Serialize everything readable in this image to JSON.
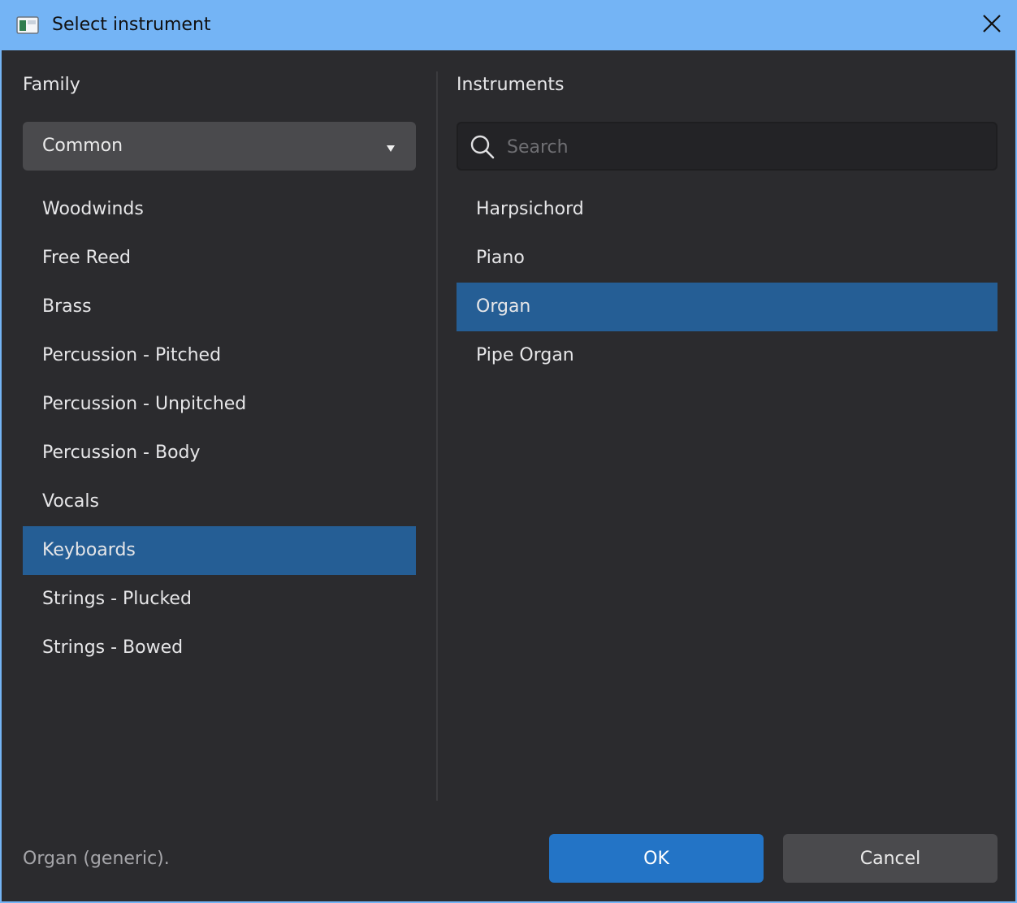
{
  "window": {
    "title": "Select instrument"
  },
  "family": {
    "heading": "Family",
    "dropdown_value": "Common",
    "items": [
      {
        "label": "Woodwinds",
        "selected": false
      },
      {
        "label": "Free Reed",
        "selected": false
      },
      {
        "label": "Brass",
        "selected": false
      },
      {
        "label": "Percussion - Pitched",
        "selected": false
      },
      {
        "label": "Percussion - Unpitched",
        "selected": false
      },
      {
        "label": "Percussion - Body",
        "selected": false
      },
      {
        "label": "Vocals",
        "selected": false
      },
      {
        "label": "Keyboards",
        "selected": true
      },
      {
        "label": "Strings - Plucked",
        "selected": false
      },
      {
        "label": "Strings - Bowed",
        "selected": false
      }
    ]
  },
  "instruments": {
    "heading": "Instruments",
    "search_placeholder": "Search",
    "search_value": "",
    "items": [
      {
        "label": "Harpsichord",
        "selected": false
      },
      {
        "label": "Piano",
        "selected": false
      },
      {
        "label": "Organ",
        "selected": true
      },
      {
        "label": "Pipe Organ",
        "selected": false
      }
    ]
  },
  "footer": {
    "description": "Organ (generic).",
    "ok_label": "OK",
    "cancel_label": "Cancel"
  },
  "icons": {
    "app": "app-window-icon",
    "close": "close-icon",
    "dropdown": "dropdown-arrow-icon",
    "search": "search-icon"
  },
  "colors": {
    "titlebar": "#74b4f5",
    "background": "#2b2b2e",
    "selection": "#255e95",
    "primary_button": "#2374c6",
    "secondary_button": "#4a4a4d"
  }
}
